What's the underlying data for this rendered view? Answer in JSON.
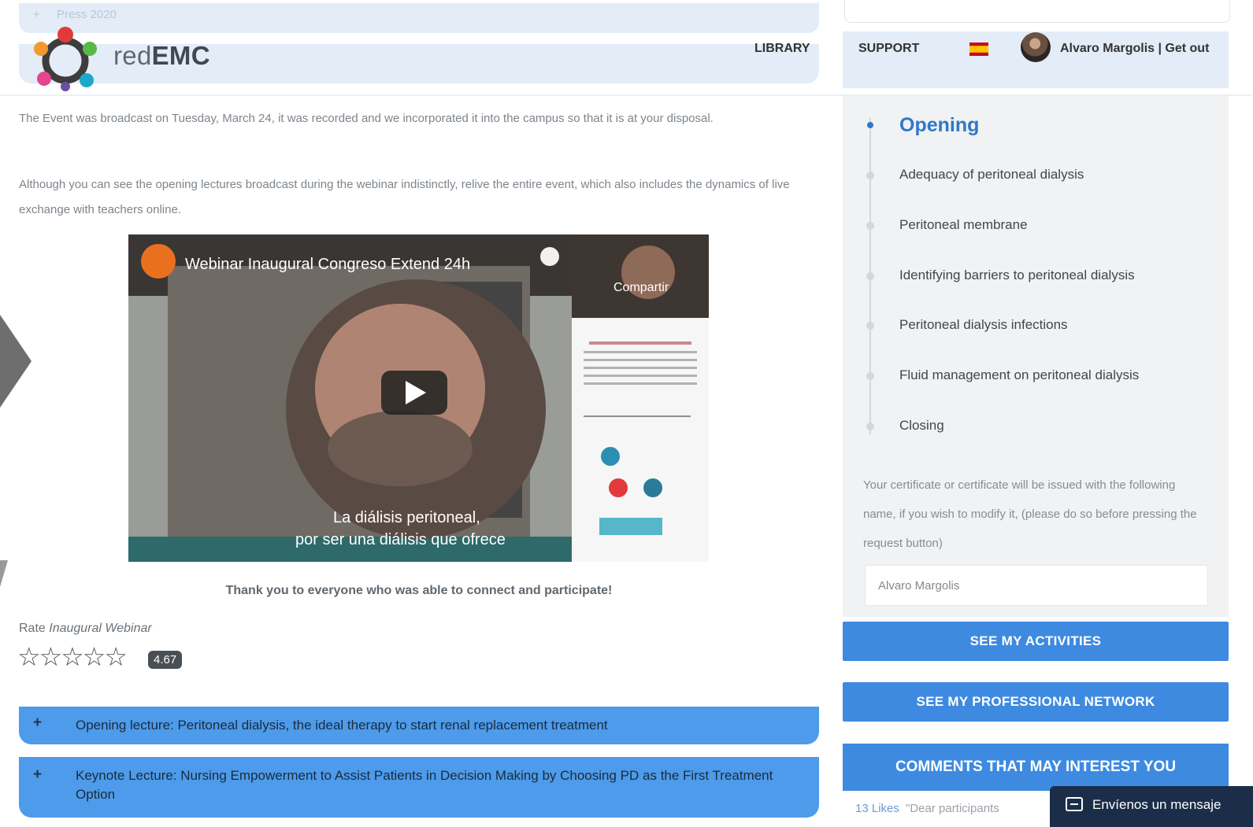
{
  "header": {
    "collapsed_item": "Press 2020",
    "logo_text_light": "red",
    "logo_text_bold": "EMC",
    "nav": {
      "library": "LIBRARY",
      "support": "SUPPORT"
    },
    "user": "Alvaro Margolis | Get out"
  },
  "content": {
    "paragraph1": "The Event was broadcast on Tuesday, March 24, it was recorded and we incorporated it into the campus so that it is at your disposal.",
    "paragraph2": "Although you can see the opening lectures broadcast during the webinar indistinctly, relive the entire event, which also includes the dynamics of live exchange with teachers online.",
    "video": {
      "title": "Webinar Inaugural Congreso Extend 24h",
      "share_label": "Compartir",
      "subtitle_line1": "La diálisis peritoneal,",
      "subtitle_line2": "por ser una diálisis que ofrece"
    },
    "thanks": "Thank you to everyone who was able to connect and participate!",
    "rate_prefix": "Rate ",
    "rate_item": "Inaugural Webinar",
    "stars": "☆☆☆☆☆",
    "rating_value": "4.67",
    "rating_fraction": 0.934,
    "accordion": [
      {
        "plus": "+",
        "label": "Opening lecture: Peritoneal dialysis, the ideal therapy to start renal replacement treatment"
      },
      {
        "plus": "+",
        "label": "Keynote Lecture: Nursing Empowerment to Assist Patients in Decision Making by Choosing PD as the First Treatment Option"
      }
    ]
  },
  "sidebar": {
    "timeline": [
      {
        "label": "Opening",
        "active": true
      },
      {
        "label": "Adequacy of peritoneal dialysis",
        "active": false
      },
      {
        "label": "Peritoneal membrane",
        "active": false
      },
      {
        "label": "Identifying barriers to peritoneal dialysis",
        "active": false
      },
      {
        "label": "Peritoneal dialysis infections",
        "active": false
      },
      {
        "label": "Fluid management on peritoneal dialysis",
        "active": false
      },
      {
        "label": "Closing",
        "active": false
      }
    ],
    "certificate_text": "Your certificate or certificate will be issued with the following name, if you wish to modify it, (please do so before pressing the request button)",
    "name_value": "Alvaro Margolis",
    "btn_activities": "SEE MY ACTIVITIES",
    "btn_network": "SEE MY PROFESSIONAL NETWORK",
    "comments_header": "COMMENTS THAT MAY INTEREST YOU",
    "comment_likes": "13 Likes",
    "comment_snippet": "\"Dear participants"
  },
  "chat": {
    "label": "Envíenos un mensaje"
  },
  "colors": {
    "accent_blue": "#3e8ae0",
    "accordion_blue": "#4d9bea",
    "header_bg": "#e3ecf7",
    "chat_bg": "#1b2d49"
  }
}
